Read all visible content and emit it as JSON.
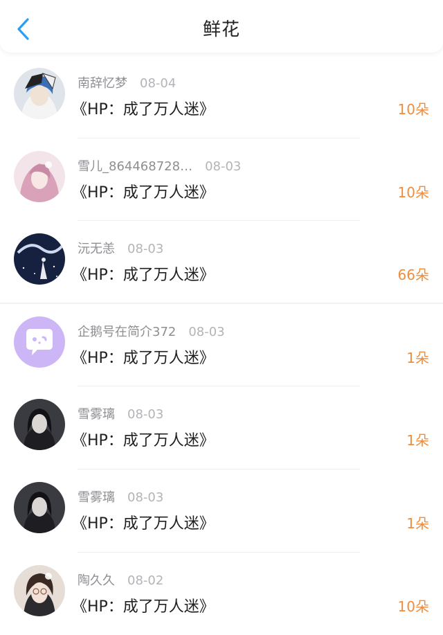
{
  "header": {
    "title": "鲜花"
  },
  "colors": {
    "accent": "#f08c3a",
    "back": "#2a9df4"
  },
  "items": [
    {
      "user": "南辞忆梦",
      "date": "08-04",
      "book": "《HP：成了万人迷》",
      "count": "10朵",
      "avatar": "anime-boy-blue-hair"
    },
    {
      "user": "雪儿_864468728…",
      "date": "08-03",
      "book": "《HP：成了万人迷》",
      "count": "10朵",
      "avatar": "pink-hair-girl"
    },
    {
      "user": "沅无恙",
      "date": "08-03",
      "book": "《HP：成了万人迷》",
      "count": "66朵",
      "avatar": "night-sky-dragon"
    },
    {
      "user": "企鹅号在简介372",
      "date": "08-03",
      "book": "《HP：成了万人迷》",
      "count": "1朵",
      "avatar": "default-chat-avatar"
    },
    {
      "user": "雪雾璃",
      "date": "08-03",
      "book": "《HP：成了万人迷》",
      "count": "1朵",
      "avatar": "dark-girl-portrait"
    },
    {
      "user": "雪雾璃",
      "date": "08-03",
      "book": "《HP：成了万人迷》",
      "count": "1朵",
      "avatar": "dark-girl-portrait"
    },
    {
      "user": "陶久久",
      "date": "08-02",
      "book": "《HP：成了万人迷》",
      "count": "10朵",
      "avatar": "girl-with-glasses"
    }
  ]
}
